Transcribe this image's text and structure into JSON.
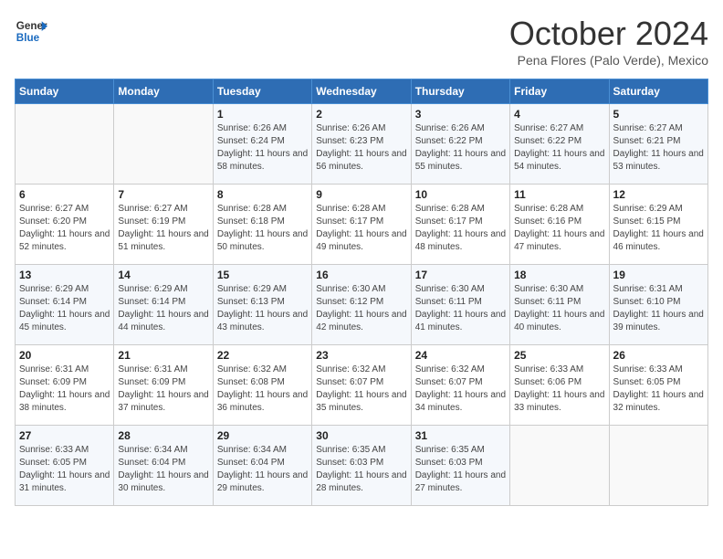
{
  "header": {
    "logo_line1": "General",
    "logo_line2": "Blue",
    "month": "October 2024",
    "location": "Pena Flores (Palo Verde), Mexico"
  },
  "days_of_week": [
    "Sunday",
    "Monday",
    "Tuesday",
    "Wednesday",
    "Thursday",
    "Friday",
    "Saturday"
  ],
  "weeks": [
    [
      {
        "day": "",
        "info": ""
      },
      {
        "day": "",
        "info": ""
      },
      {
        "day": "1",
        "info": "Sunrise: 6:26 AM\nSunset: 6:24 PM\nDaylight: 11 hours and 58 minutes."
      },
      {
        "day": "2",
        "info": "Sunrise: 6:26 AM\nSunset: 6:23 PM\nDaylight: 11 hours and 56 minutes."
      },
      {
        "day": "3",
        "info": "Sunrise: 6:26 AM\nSunset: 6:22 PM\nDaylight: 11 hours and 55 minutes."
      },
      {
        "day": "4",
        "info": "Sunrise: 6:27 AM\nSunset: 6:22 PM\nDaylight: 11 hours and 54 minutes."
      },
      {
        "day": "5",
        "info": "Sunrise: 6:27 AM\nSunset: 6:21 PM\nDaylight: 11 hours and 53 minutes."
      }
    ],
    [
      {
        "day": "6",
        "info": "Sunrise: 6:27 AM\nSunset: 6:20 PM\nDaylight: 11 hours and 52 minutes."
      },
      {
        "day": "7",
        "info": "Sunrise: 6:27 AM\nSunset: 6:19 PM\nDaylight: 11 hours and 51 minutes."
      },
      {
        "day": "8",
        "info": "Sunrise: 6:28 AM\nSunset: 6:18 PM\nDaylight: 11 hours and 50 minutes."
      },
      {
        "day": "9",
        "info": "Sunrise: 6:28 AM\nSunset: 6:17 PM\nDaylight: 11 hours and 49 minutes."
      },
      {
        "day": "10",
        "info": "Sunrise: 6:28 AM\nSunset: 6:17 PM\nDaylight: 11 hours and 48 minutes."
      },
      {
        "day": "11",
        "info": "Sunrise: 6:28 AM\nSunset: 6:16 PM\nDaylight: 11 hours and 47 minutes."
      },
      {
        "day": "12",
        "info": "Sunrise: 6:29 AM\nSunset: 6:15 PM\nDaylight: 11 hours and 46 minutes."
      }
    ],
    [
      {
        "day": "13",
        "info": "Sunrise: 6:29 AM\nSunset: 6:14 PM\nDaylight: 11 hours and 45 minutes."
      },
      {
        "day": "14",
        "info": "Sunrise: 6:29 AM\nSunset: 6:14 PM\nDaylight: 11 hours and 44 minutes."
      },
      {
        "day": "15",
        "info": "Sunrise: 6:29 AM\nSunset: 6:13 PM\nDaylight: 11 hours and 43 minutes."
      },
      {
        "day": "16",
        "info": "Sunrise: 6:30 AM\nSunset: 6:12 PM\nDaylight: 11 hours and 42 minutes."
      },
      {
        "day": "17",
        "info": "Sunrise: 6:30 AM\nSunset: 6:11 PM\nDaylight: 11 hours and 41 minutes."
      },
      {
        "day": "18",
        "info": "Sunrise: 6:30 AM\nSunset: 6:11 PM\nDaylight: 11 hours and 40 minutes."
      },
      {
        "day": "19",
        "info": "Sunrise: 6:31 AM\nSunset: 6:10 PM\nDaylight: 11 hours and 39 minutes."
      }
    ],
    [
      {
        "day": "20",
        "info": "Sunrise: 6:31 AM\nSunset: 6:09 PM\nDaylight: 11 hours and 38 minutes."
      },
      {
        "day": "21",
        "info": "Sunrise: 6:31 AM\nSunset: 6:09 PM\nDaylight: 11 hours and 37 minutes."
      },
      {
        "day": "22",
        "info": "Sunrise: 6:32 AM\nSunset: 6:08 PM\nDaylight: 11 hours and 36 minutes."
      },
      {
        "day": "23",
        "info": "Sunrise: 6:32 AM\nSunset: 6:07 PM\nDaylight: 11 hours and 35 minutes."
      },
      {
        "day": "24",
        "info": "Sunrise: 6:32 AM\nSunset: 6:07 PM\nDaylight: 11 hours and 34 minutes."
      },
      {
        "day": "25",
        "info": "Sunrise: 6:33 AM\nSunset: 6:06 PM\nDaylight: 11 hours and 33 minutes."
      },
      {
        "day": "26",
        "info": "Sunrise: 6:33 AM\nSunset: 6:05 PM\nDaylight: 11 hours and 32 minutes."
      }
    ],
    [
      {
        "day": "27",
        "info": "Sunrise: 6:33 AM\nSunset: 6:05 PM\nDaylight: 11 hours and 31 minutes."
      },
      {
        "day": "28",
        "info": "Sunrise: 6:34 AM\nSunset: 6:04 PM\nDaylight: 11 hours and 30 minutes."
      },
      {
        "day": "29",
        "info": "Sunrise: 6:34 AM\nSunset: 6:04 PM\nDaylight: 11 hours and 29 minutes."
      },
      {
        "day": "30",
        "info": "Sunrise: 6:35 AM\nSunset: 6:03 PM\nDaylight: 11 hours and 28 minutes."
      },
      {
        "day": "31",
        "info": "Sunrise: 6:35 AM\nSunset: 6:03 PM\nDaylight: 11 hours and 27 minutes."
      },
      {
        "day": "",
        "info": ""
      },
      {
        "day": "",
        "info": ""
      }
    ]
  ]
}
